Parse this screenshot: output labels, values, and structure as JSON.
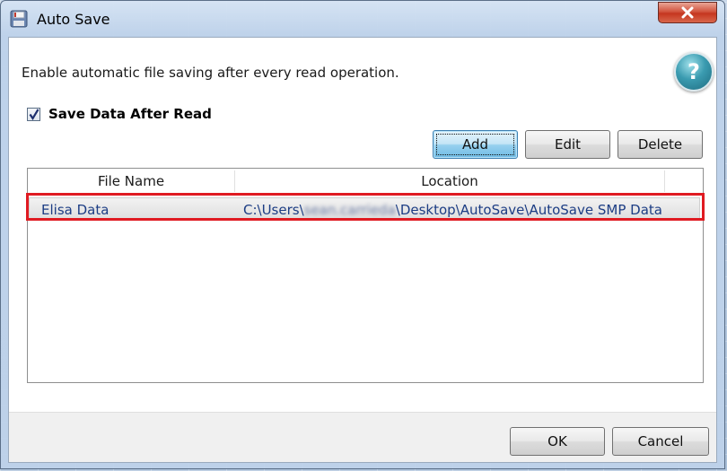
{
  "window": {
    "title": "Auto Save",
    "close_label": "close"
  },
  "content": {
    "description": "Enable automatic file saving after every read operation.",
    "help_label": "?",
    "checkbox": {
      "label": "Save Data After Read",
      "checked": true
    }
  },
  "toolbar": {
    "add_label": "Add",
    "edit_label": "Edit",
    "delete_label": "Delete"
  },
  "table": {
    "columns": [
      "File Name",
      "Location"
    ],
    "rows": [
      {
        "file_name": "Elisa Data",
        "location_prefix": "C:\\Users\\",
        "location_redacted": "sean.carrieda",
        "location_suffix": "\\Desktop\\AutoSave\\AutoSave SMP Data"
      }
    ]
  },
  "footer": {
    "ok_label": "OK",
    "cancel_label": "Cancel"
  },
  "colors": {
    "highlight": "#e01b22",
    "link_text": "#1c3d84",
    "default_button": "#98d1ef"
  }
}
